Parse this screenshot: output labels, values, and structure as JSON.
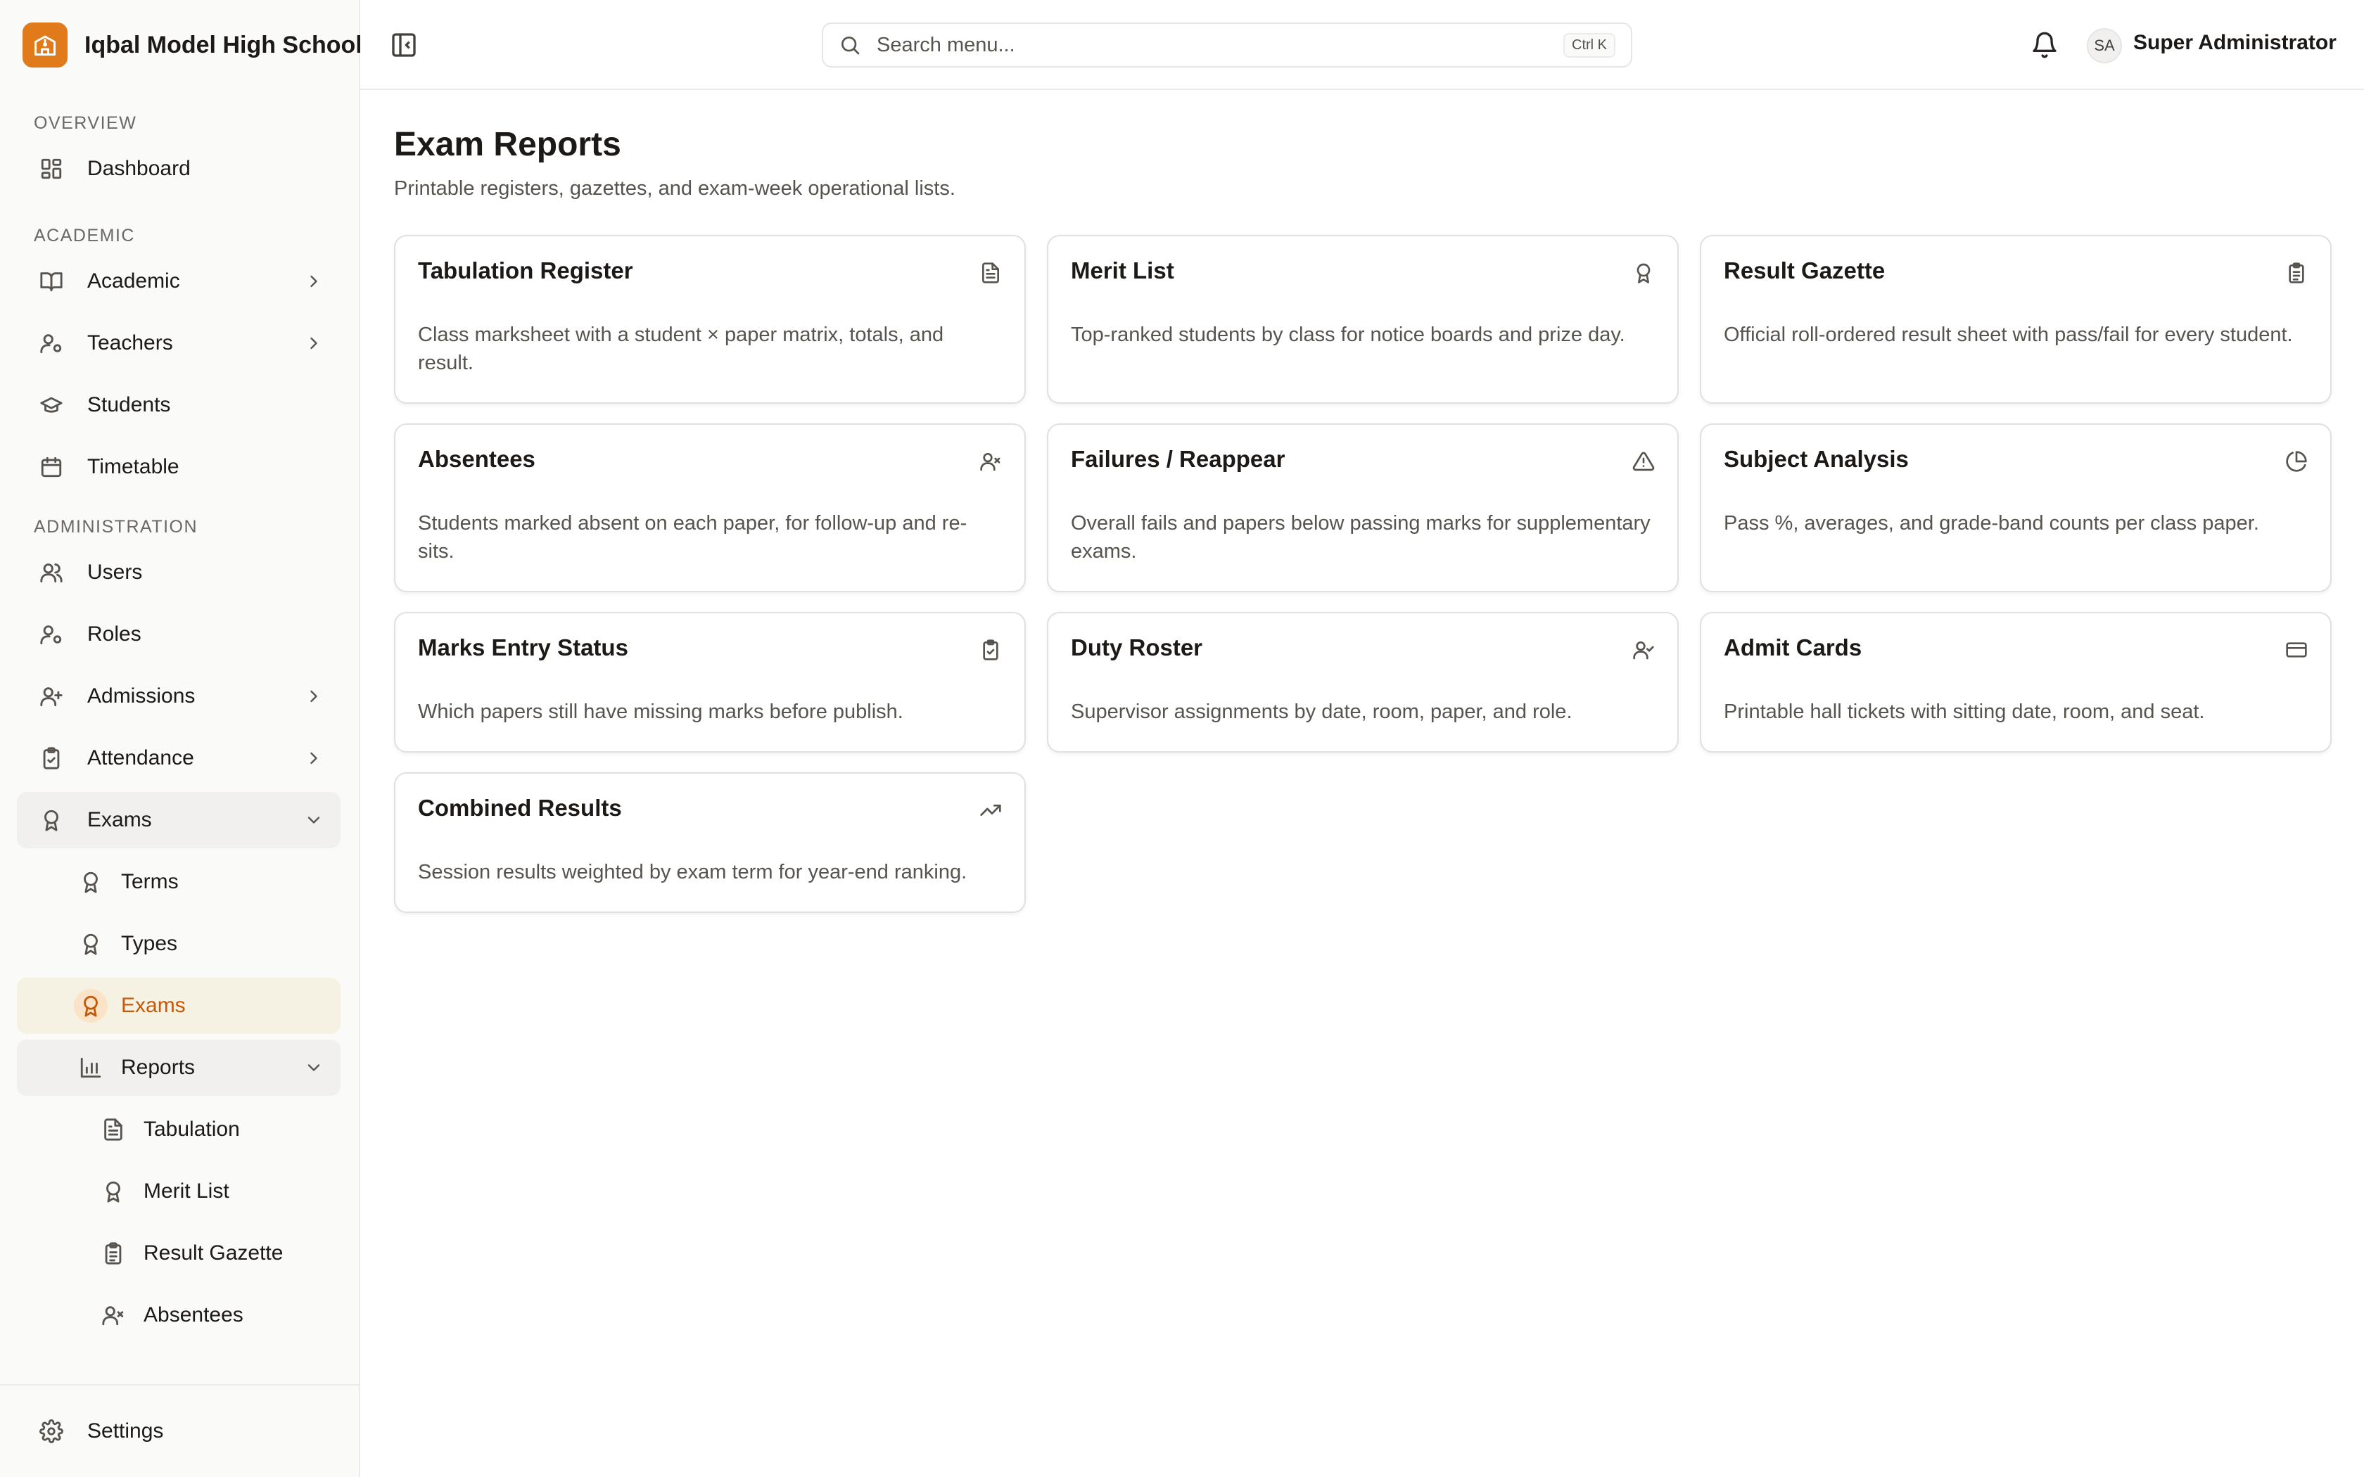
{
  "app": {
    "name": "Iqbal Model High School",
    "brand_icon": "school-icon",
    "accent_color": "#e07a1a"
  },
  "sidebar": {
    "sections": [
      {
        "label": "OVERVIEW"
      },
      {
        "label": "ACADEMIC"
      },
      {
        "label": "ADMINISTRATION"
      }
    ],
    "items": {
      "dashboard": {
        "label": "Dashboard",
        "icon": "dashboard-icon"
      },
      "academic": {
        "label": "Academic",
        "icon": "book-icon"
      },
      "teachers": {
        "label": "Teachers",
        "icon": "teacher-icon"
      },
      "students": {
        "label": "Students",
        "icon": "graduation-cap-icon"
      },
      "timetable": {
        "label": "Timetable",
        "icon": "calendar-icon"
      },
      "users": {
        "label": "Users",
        "icon": "users-icon"
      },
      "roles": {
        "label": "Roles",
        "icon": "roles-icon"
      },
      "admissions": {
        "label": "Admissions",
        "icon": "user-plus-icon"
      },
      "attendance": {
        "label": "Attendance",
        "icon": "clipboard-check-icon"
      },
      "exams": {
        "label": "Exams",
        "icon": "award-icon"
      },
      "terms": {
        "label": "Terms",
        "icon": "award-icon"
      },
      "types": {
        "label": "Types",
        "icon": "award-icon"
      },
      "exams_sub": {
        "label": "Exams",
        "icon": "award-icon"
      },
      "reports": {
        "label": "Reports",
        "icon": "bar-chart-icon"
      },
      "tabulation": {
        "label": "Tabulation",
        "icon": "file-text-icon"
      },
      "merit_list": {
        "label": "Merit List",
        "icon": "award-icon"
      },
      "result_gazette": {
        "label": "Result Gazette",
        "icon": "clipboard-list-icon"
      },
      "absentees": {
        "label": "Absentees",
        "icon": "user-x-icon"
      }
    },
    "settings": {
      "label": "Settings",
      "icon": "gear-icon"
    }
  },
  "topbar": {
    "search_placeholder": "Search menu...",
    "search_shortcut": "Ctrl K",
    "user_initials": "SA",
    "user_name": "Super Administrator"
  },
  "page": {
    "title": "Exam Reports",
    "subtitle": "Printable registers, gazettes, and exam-week operational lists."
  },
  "cards": [
    {
      "title": "Tabulation Register",
      "icon": "file-text-icon",
      "description": "Class marksheet with a student × paper matrix, totals, and result."
    },
    {
      "title": "Merit List",
      "icon": "award-icon",
      "description": "Top-ranked students by class for notice boards and prize day."
    },
    {
      "title": "Result Gazette",
      "icon": "clipboard-list-icon",
      "description": "Official roll-ordered result sheet with pass/fail for every student."
    },
    {
      "title": "Absentees",
      "icon": "user-x-icon",
      "description": "Students marked absent on each paper, for follow-up and re-sits."
    },
    {
      "title": "Failures / Reappear",
      "icon": "warning-triangle-icon",
      "description": "Overall fails and papers below passing marks for supplementary exams."
    },
    {
      "title": "Subject Analysis",
      "icon": "pie-chart-icon",
      "description": "Pass %, averages, and grade-band counts per class paper."
    },
    {
      "title": "Marks Entry Status",
      "icon": "clipboard-check-icon",
      "description": "Which papers still have missing marks before publish."
    },
    {
      "title": "Duty Roster",
      "icon": "user-check-icon",
      "description": "Supervisor assignments by date, room, paper, and role."
    },
    {
      "title": "Admit Cards",
      "icon": "credit-card-icon",
      "description": "Printable hall tickets with sitting date, room, and seat."
    },
    {
      "title": "Combined Results",
      "icon": "trending-up-icon",
      "description": "Session results weighted by exam term for year-end ranking."
    }
  ]
}
